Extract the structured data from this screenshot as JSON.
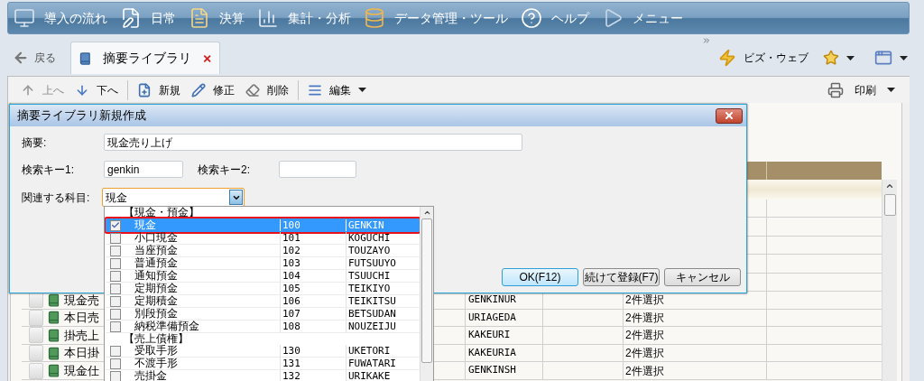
{
  "menu_bar": [
    {
      "label": "導入の流れ"
    },
    {
      "label": "日常"
    },
    {
      "label": "決算"
    },
    {
      "label": "集計・分析"
    },
    {
      "label": "データ管理・ツール"
    },
    {
      "label": "ヘルプ"
    },
    {
      "label": "メニュー"
    }
  ],
  "nav": {
    "back": "戻る",
    "tab": {
      "label": "摘要ライブラリ",
      "selected": true
    },
    "biz_web": "ビズ・ウェブ"
  },
  "toolbar": {
    "buttons": [
      {
        "label": "上へ",
        "disabled": true
      },
      {
        "label": "下へ",
        "disabled": false
      },
      {
        "label": "新規",
        "disabled": false
      },
      {
        "label": "修正",
        "disabled": false
      },
      {
        "label": "削除",
        "disabled": false
      },
      {
        "label": "編集",
        "disabled": false
      }
    ],
    "print": "印刷"
  },
  "table": {
    "rows": [
      {
        "name": "現金売",
        "code": "GENKINUR",
        "status": "2件選択",
        "checked": false
      },
      {
        "name": "本日売",
        "code": "URIAGEDA",
        "status": "2件選択",
        "checked": false
      },
      {
        "name": "掛売上",
        "code": "KAKEURI",
        "status": "2件選択",
        "checked": false
      },
      {
        "name": "本日掛",
        "code": "KAKEURIA",
        "status": "2件選択",
        "checked": false
      },
      {
        "name": "現金仕",
        "code": "GENKINSH",
        "status": "2件選択",
        "checked": false
      }
    ]
  },
  "dialog": {
    "title": "摘要ライブラリ新規作成",
    "summary": {
      "label": "摘要:",
      "value": "現金売り上げ"
    },
    "key1": {
      "label": "検索キー1:",
      "value": "genkin"
    },
    "key2": {
      "label": "検索キー2:"
    },
    "account": {
      "label": "関連する科目:",
      "value": "現金",
      "expanded": true
    },
    "buttons": [
      {
        "label": "OK(F12)",
        "default": true
      },
      {
        "label": "続けて登録(F7)",
        "default": false
      },
      {
        "label": "キャンセル",
        "default": false
      }
    ]
  },
  "dropdown": [
    {
      "kind": "group",
      "label": "【現金・預金】"
    },
    {
      "kind": "account",
      "name": "現金",
      "code": "100",
      "reading": "GENKIN",
      "checked": true,
      "selected": true
    },
    {
      "kind": "account",
      "name": "小口現金",
      "code": "101",
      "reading": "KOGUCHI",
      "checked": false,
      "selected": false
    },
    {
      "kind": "account",
      "name": "当座預金",
      "code": "102",
      "reading": "TOUZAYO",
      "checked": false,
      "selected": false
    },
    {
      "kind": "account",
      "name": "普通預金",
      "code": "103",
      "reading": "FUTSUUYO",
      "checked": false,
      "selected": false
    },
    {
      "kind": "account",
      "name": "通知預金",
      "code": "104",
      "reading": "TSUUCHI",
      "checked": false,
      "selected": false
    },
    {
      "kind": "account",
      "name": "定期預金",
      "code": "105",
      "reading": "TEIKIYO",
      "checked": false,
      "selected": false
    },
    {
      "kind": "account",
      "name": "定期積金",
      "code": "106",
      "reading": "TEIKITSU",
      "checked": false,
      "selected": false
    },
    {
      "kind": "account",
      "name": "別段預金",
      "code": "107",
      "reading": "BETSUDAN",
      "checked": false,
      "selected": false
    },
    {
      "kind": "account",
      "name": "納税準備預金",
      "code": "108",
      "reading": "NOUZEIJU",
      "checked": false,
      "selected": false
    },
    {
      "kind": "group",
      "label": "【売上債権】"
    },
    {
      "kind": "account",
      "name": "受取手形",
      "code": "130",
      "reading": "UKETORI",
      "checked": false,
      "selected": false
    },
    {
      "kind": "account",
      "name": "不渡手形",
      "code": "131",
      "reading": "FUWATARI",
      "checked": false,
      "selected": false
    },
    {
      "kind": "account",
      "name": "売掛金",
      "code": "132",
      "reading": "URIKAKE",
      "checked": false,
      "selected": false
    }
  ]
}
